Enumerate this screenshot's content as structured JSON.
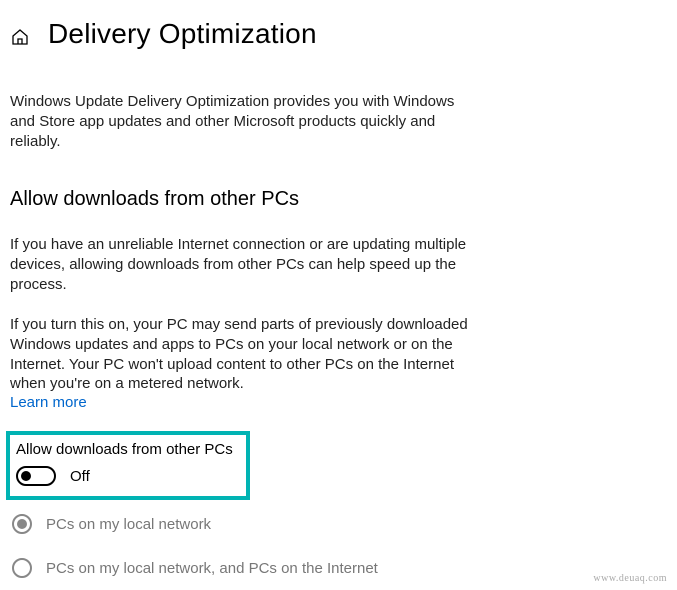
{
  "header": {
    "title": "Delivery Optimization",
    "homeIcon": "home-icon"
  },
  "intro": "Windows Update Delivery Optimization provides you with Windows and Store app updates and other Microsoft products quickly and reliably.",
  "section": {
    "title": "Allow downloads from other PCs",
    "para1": "If you have an unreliable Internet connection or are updating multiple devices, allowing downloads from other PCs can help speed up the process.",
    "para2": "If you turn this on, your PC may send parts of previously downloaded Windows updates and apps to PCs on your local network or on the Internet. Your PC won't upload content to other PCs on the Internet when you're on a metered network.",
    "learnMore": "Learn more"
  },
  "toggle": {
    "label": "Allow downloads from other PCs",
    "state": "Off"
  },
  "radios": {
    "option1": "PCs on my local network",
    "option2": "PCs on my local network, and PCs on the Internet"
  },
  "watermark": "www.deuaq.com"
}
